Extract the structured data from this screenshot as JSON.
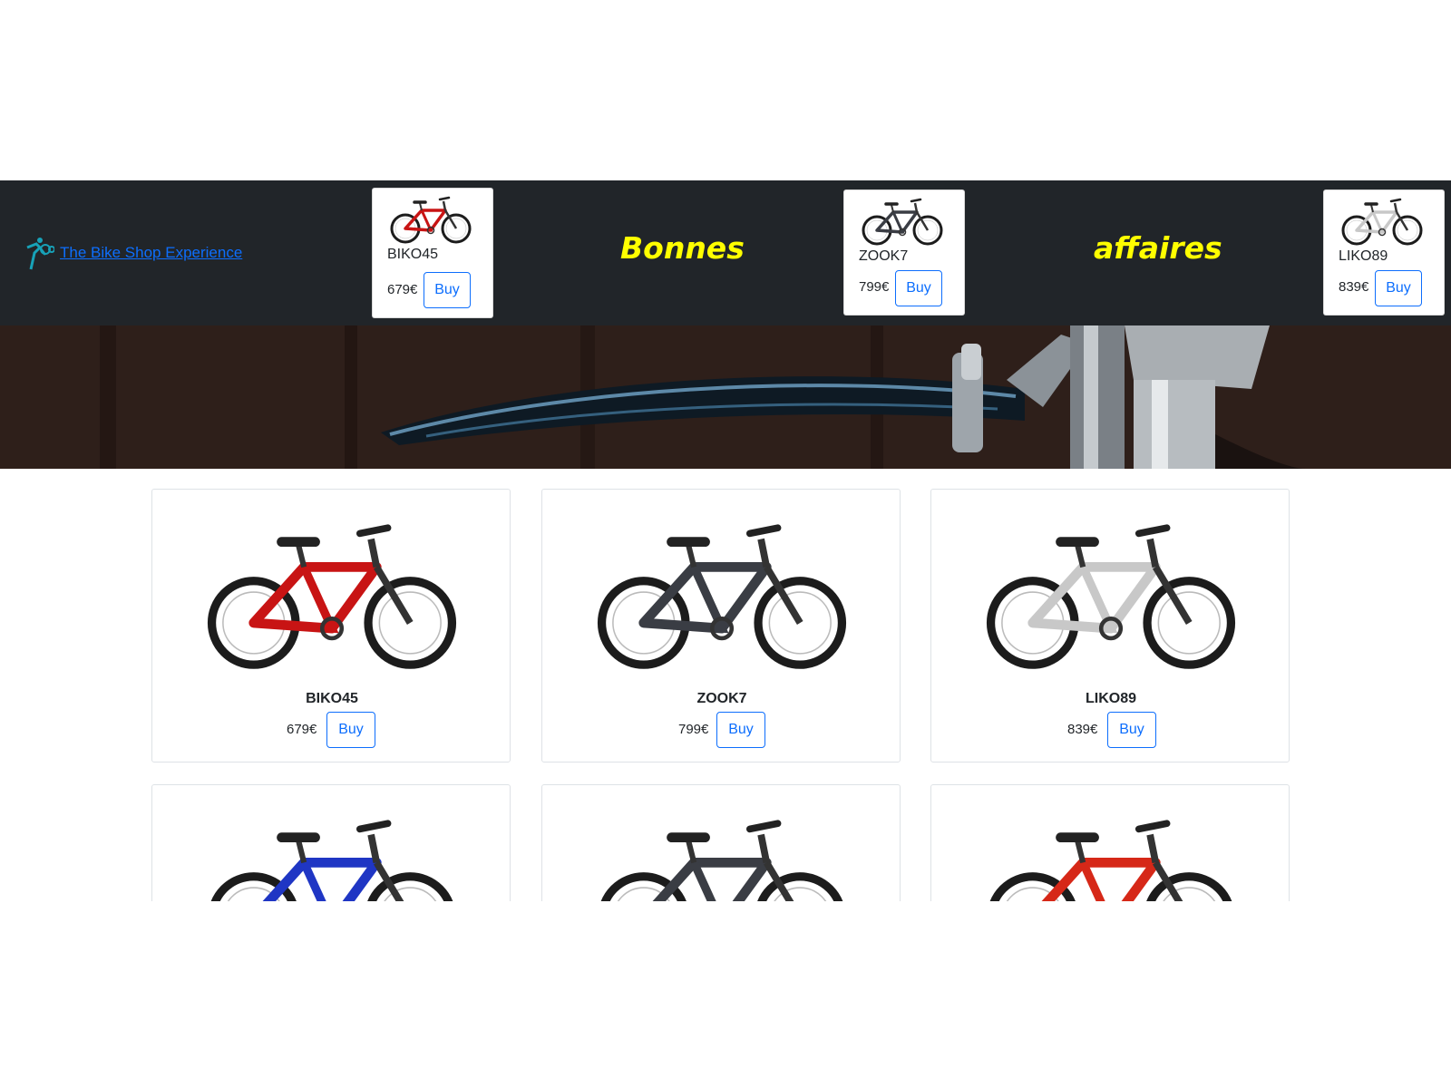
{
  "brand": {
    "name": "The Bike Shop Experience",
    "logo_icon": "cyclist-logo-icon"
  },
  "promo": {
    "word1": "Bonnes",
    "word2": "affaires",
    "color": "#ffff00"
  },
  "deals": [
    {
      "name": "BIKO45",
      "price": "679€",
      "buy": "Buy",
      "color": "#c81414"
    },
    {
      "name": "ZOOK7",
      "price": "799€",
      "buy": "Buy",
      "color": "#3a3d44"
    },
    {
      "name": "LIKO89",
      "price": "839€",
      "buy": "Buy",
      "color": "#f2f2f2"
    }
  ],
  "products": [
    {
      "name": "BIKO45",
      "price": "679€",
      "buy": "Buy",
      "color": "#c81414"
    },
    {
      "name": "ZOOK7",
      "price": "799€",
      "buy": "Buy",
      "color": "#3a3d44"
    },
    {
      "name": "LIKO89",
      "price": "839€",
      "buy": "Buy",
      "color": "#f2f2f2"
    },
    {
      "color": "#1f36c4"
    },
    {
      "color": "#3a3d44"
    },
    {
      "color": "#d62818"
    }
  ]
}
